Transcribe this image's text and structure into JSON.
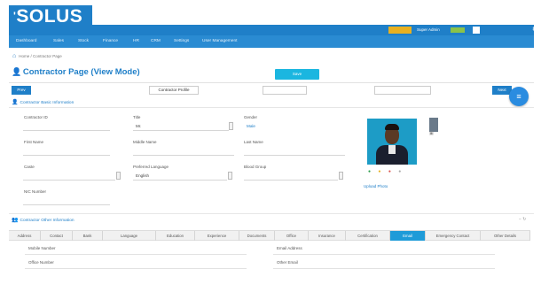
{
  "brand": {
    "logo_text": "SOLUS",
    "logo_tick": "'"
  },
  "topbar": {
    "config_text": "",
    "orange_badge": "",
    "role_text": "Super Admin",
    "role_badge": "",
    "user_text": "",
    "settings_icon": "gear-icon"
  },
  "nav": {
    "items": [
      "Dashboard",
      "Sales",
      "Stock",
      "Finance",
      "HR",
      "CRM",
      "Settings",
      "User Management"
    ],
    "right": ""
  },
  "breadcrumb": {
    "home_icon": "home-icon",
    "text": "Home / Contractor Page"
  },
  "page": {
    "title": "Contractor Page (View Mode)",
    "subtitle": "",
    "save_button": "Save"
  },
  "actions": {
    "prev": "Prev",
    "tabs": [
      "Contractor Profile",
      "",
      ""
    ],
    "next": "Next"
  },
  "basic_info": {
    "header": "Contractor Basic Information",
    "fields": {
      "contractor_id": {
        "label": "Contractor ID",
        "value": ""
      },
      "title": {
        "label": "Title",
        "value": "Mr."
      },
      "gender": {
        "label": "Gender",
        "value": "Male"
      },
      "first_name": {
        "label": "First Name",
        "value": ""
      },
      "middle_name": {
        "label": "Middle Name",
        "value": ""
      },
      "last_name": {
        "label": "Last Name",
        "value": ""
      },
      "caste": {
        "label": "Caste",
        "value": ""
      },
      "preferred_language": {
        "label": "Preferred Language",
        "value": "English"
      },
      "blood_group": {
        "label": "Blood Group",
        "value": ""
      },
      "nic_number": {
        "label": "NIC Number",
        "value": ""
      }
    },
    "photo_link": "Upload Photo"
  },
  "other_info": {
    "header": "Contractor Other Information",
    "tabs": [
      "Address",
      "Contact",
      "Bank",
      "Language",
      "Education",
      "Experience",
      "Documents",
      "Office",
      "Insurance",
      "Certification",
      "Email",
      "Emergency Contact",
      "Other Details"
    ],
    "active_tab_index": 10,
    "rows": {
      "mobile_number": {
        "label": "Mobile Number",
        "value": ""
      },
      "email_address": {
        "label": "Email Address",
        "value": ""
      },
      "office_number": {
        "label": "Office Number",
        "value": ""
      },
      "other_email": {
        "label": "Other Email",
        "value": ""
      }
    }
  },
  "colors": {
    "primary": "#1f7fc8",
    "nav": "#2a8bd2",
    "accent": "#1bb6e0",
    "warning": "#e8b020",
    "success": "#8bc34a"
  }
}
